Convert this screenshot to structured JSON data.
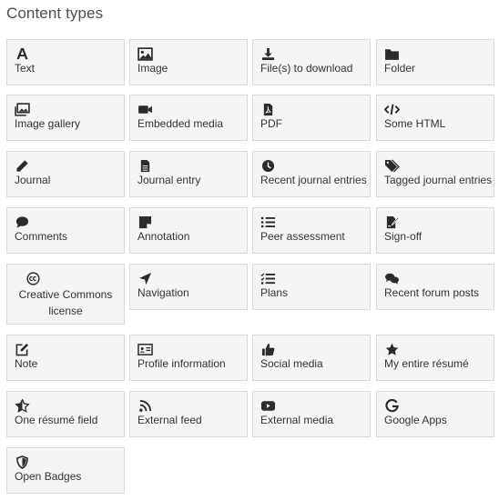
{
  "heading": "Content types",
  "tiles": [
    {
      "label": "Text",
      "icon": "text-icon"
    },
    {
      "label": "Image",
      "icon": "image-icon"
    },
    {
      "label": "File(s) to download",
      "icon": "download-icon"
    },
    {
      "label": "Folder",
      "icon": "folder-icon"
    },
    {
      "label": "Image gallery",
      "icon": "image-gallery-icon"
    },
    {
      "label": "Embedded media",
      "icon": "video-camera-icon"
    },
    {
      "label": "PDF",
      "icon": "pdf-icon"
    },
    {
      "label": "Some HTML",
      "icon": "code-icon"
    },
    {
      "label": "Journal",
      "icon": "pencil-icon"
    },
    {
      "label": "Journal entry",
      "icon": "document-icon"
    },
    {
      "label": "Recent journal entries",
      "icon": "clock-icon"
    },
    {
      "label": "Tagged journal entries",
      "icon": "tags-icon"
    },
    {
      "label": "Comments",
      "icon": "comment-icon"
    },
    {
      "label": "Annotation",
      "icon": "sticky-note-icon"
    },
    {
      "label": "Peer assessment",
      "icon": "list-icon"
    },
    {
      "label": "Sign-off",
      "icon": "signature-icon"
    },
    {
      "label": "Creative Commons license",
      "icon": "creative-commons-icon"
    },
    {
      "label": "Navigation",
      "icon": "location-arrow-icon"
    },
    {
      "label": "Plans",
      "icon": "checklist-icon"
    },
    {
      "label": "Recent forum posts",
      "icon": "comments-icon"
    },
    {
      "label": "Note",
      "icon": "edit-icon"
    },
    {
      "label": "Profile information",
      "icon": "id-card-icon"
    },
    {
      "label": "Social media",
      "icon": "thumbs-up-icon"
    },
    {
      "label": "My entire résumé",
      "icon": "star-icon"
    },
    {
      "label": "One résumé field",
      "icon": "star-half-icon"
    },
    {
      "label": "External feed",
      "icon": "rss-icon"
    },
    {
      "label": "External media",
      "icon": "youtube-icon"
    },
    {
      "label": "Google Apps",
      "icon": "google-icon"
    },
    {
      "label": "Open Badges",
      "icon": "shield-icon"
    }
  ]
}
